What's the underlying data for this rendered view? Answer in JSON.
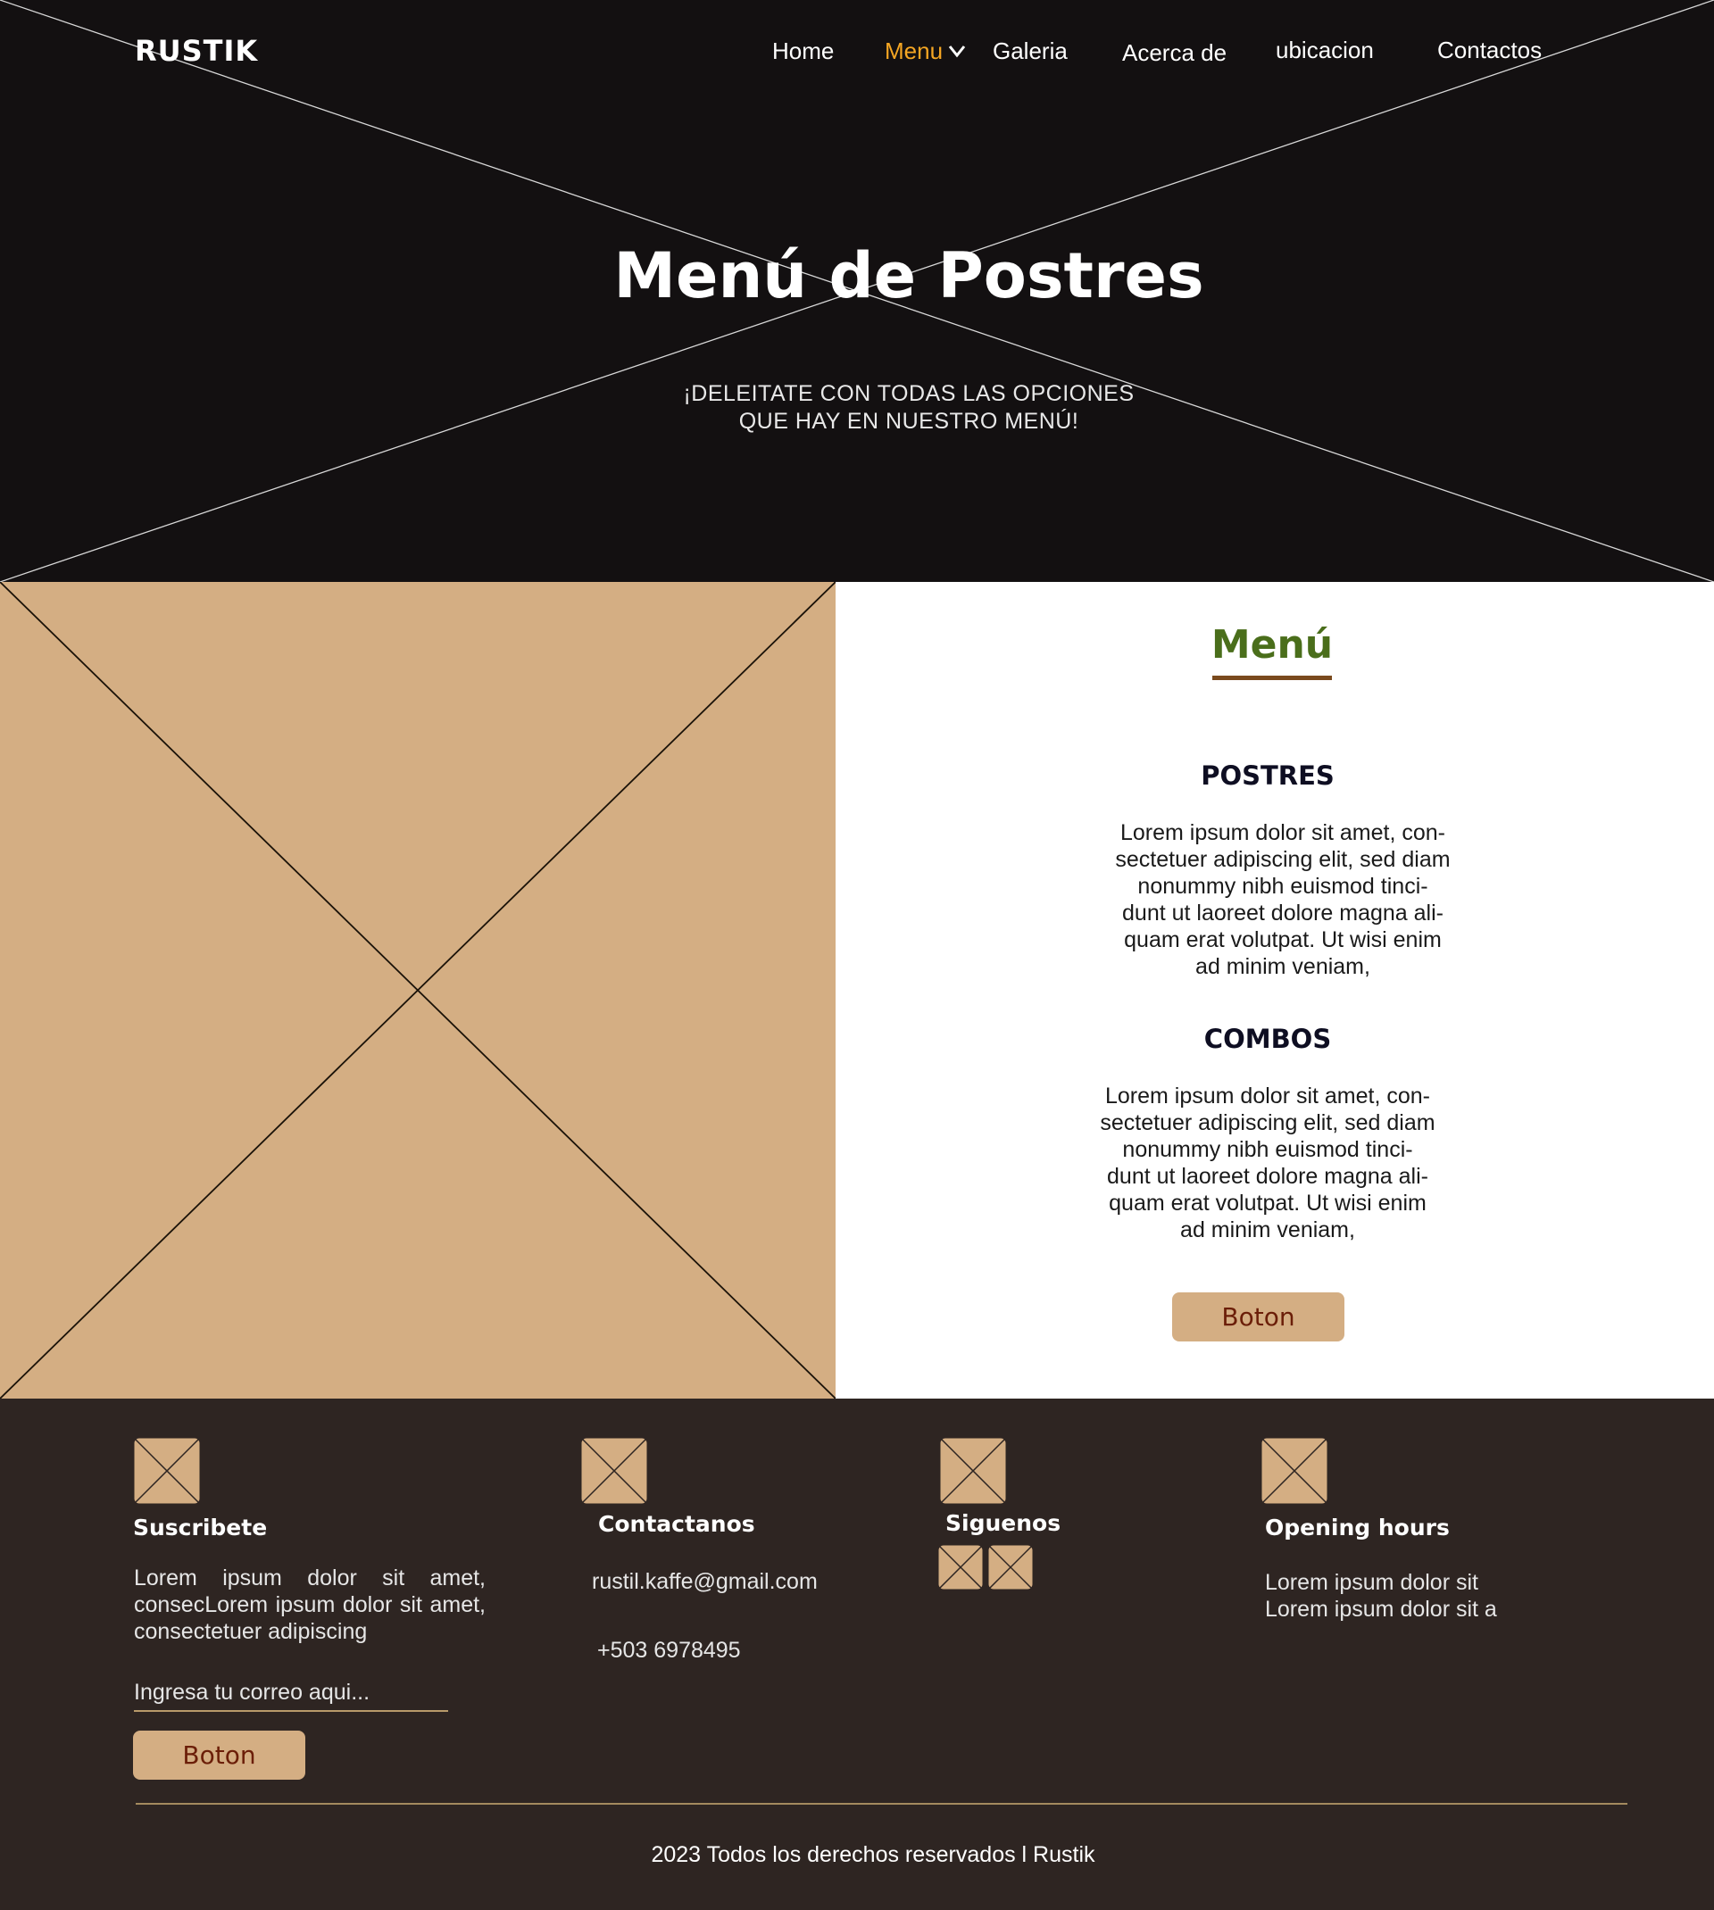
{
  "brand": {
    "logo": "RUSTIK"
  },
  "nav": {
    "items": [
      "Home",
      "Menu",
      "Galeria",
      "Acerca de",
      "ubicacion",
      "Contactos"
    ],
    "active": "Menu"
  },
  "hero": {
    "title": "Menú de Postres",
    "subtitle_lines": [
      "¡DELEITATE CON TODAS LAS OPCIONES",
      "QUE HAY EN NUESTRO MENÚ!"
    ]
  },
  "menu": {
    "heading": "Menú",
    "sections": [
      {
        "title": "POSTRES",
        "body_lines": [
          "Lorem ipsum dolor sit amet, con-",
          "sectetuer adipiscing elit, sed diam",
          "nonummy nibh euismod tinci-",
          "dunt ut laoreet dolore magna ali-",
          "quam erat volutpat. Ut wisi enim",
          "ad minim veniam,"
        ]
      },
      {
        "title": "COMBOS",
        "body_lines": [
          "Lorem ipsum dolor sit amet, con-",
          "sectetuer adipiscing elit, sed diam",
          "nonummy nibh euismod tinci-",
          "dunt ut laoreet dolore magna ali-",
          "quam erat volutpat. Ut wisi enim",
          "ad minim veniam,"
        ]
      }
    ],
    "button_label": "Boton"
  },
  "footer": {
    "subscribe": {
      "title": "Suscribete",
      "body": "Lorem ipsum dolor sit amet, consecLorem ipsum dolor sit amet, consectetuer adipiscing",
      "input_placeholder": "Ingresa tu correo aqui...",
      "button_label": "Boton"
    },
    "contact": {
      "title": "Contactanos",
      "email": "rustil.kaffe@gmail.com",
      "phone": "+503 6978495"
    },
    "follow": {
      "title": "Siguenos"
    },
    "hours": {
      "title": "Opening hours",
      "lines": [
        "Lorem ipsum dolor sit",
        "Lorem ipsum dolor sit a"
      ]
    },
    "copyright": "2023 Todos los derechos reservados l Rustik"
  },
  "colors": {
    "hero_bg": "#131011",
    "accent_nav": "#f5a623",
    "tan": "#d4ae83",
    "menu_heading": "#4a6e1b",
    "underline": "#7a4a1e",
    "button_text": "#6b1e08",
    "footer_bg": "#2e2522"
  }
}
